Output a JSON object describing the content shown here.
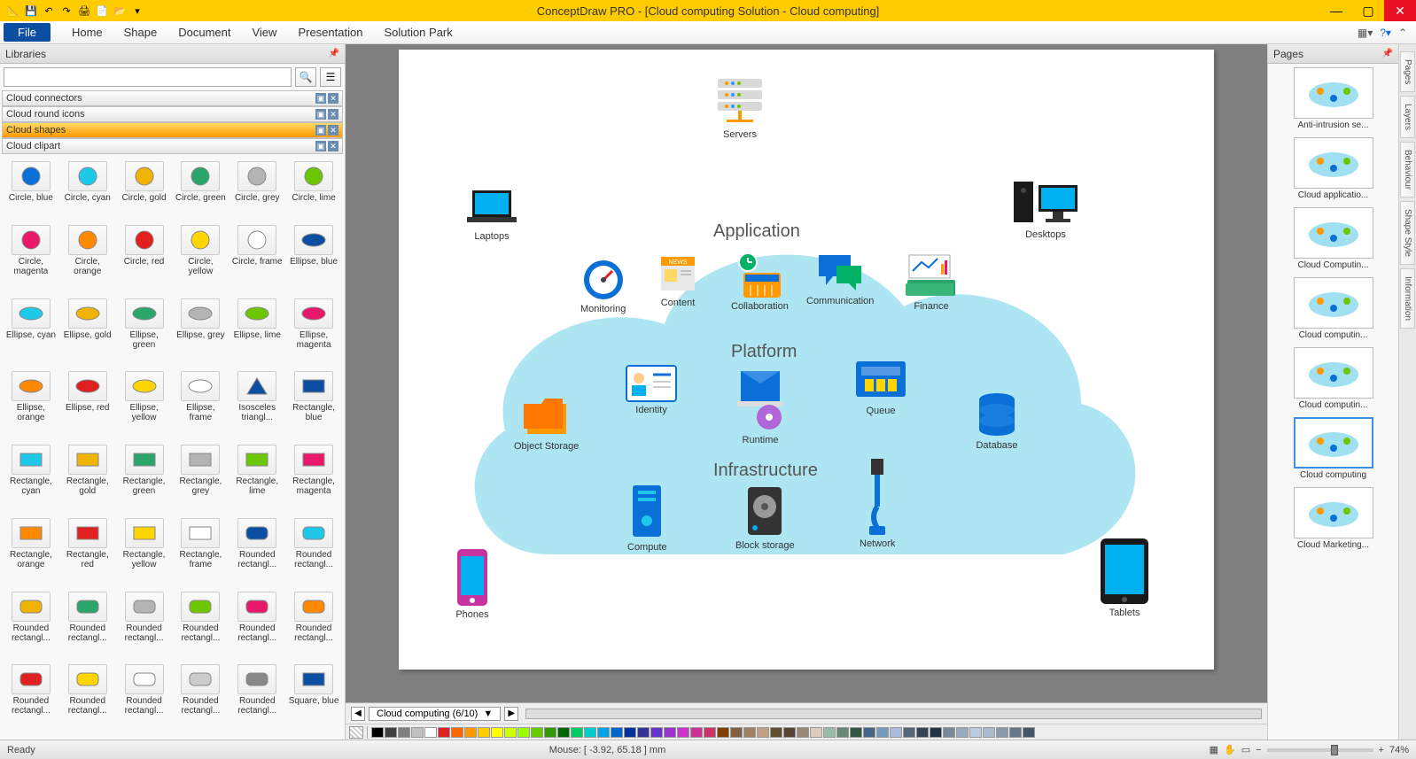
{
  "titlebar": {
    "title": "ConceptDraw PRO - [Cloud computing Solution - Cloud computing]"
  },
  "menubar": {
    "file": "File",
    "items": [
      "Home",
      "Shape",
      "Document",
      "View",
      "Presentation",
      "Solution Park"
    ]
  },
  "libraries": {
    "title": "Libraries",
    "search_placeholder": "",
    "sections": [
      {
        "name": "Cloud connectors",
        "active": false
      },
      {
        "name": "Cloud round icons",
        "active": false
      },
      {
        "name": "Cloud shapes",
        "active": true
      },
      {
        "name": "Cloud clipart",
        "active": false
      }
    ],
    "shapes": [
      {
        "label": "Circle, blue",
        "type": "circle",
        "color": "#0b6fd8"
      },
      {
        "label": "Circle, cyan",
        "type": "circle",
        "color": "#1ec8e8"
      },
      {
        "label": "Circle, gold",
        "type": "circle",
        "color": "#f0b400"
      },
      {
        "label": "Circle, green",
        "type": "circle",
        "color": "#2aa66b"
      },
      {
        "label": "Circle, grey",
        "type": "circle",
        "color": "#b4b4b4"
      },
      {
        "label": "Circle, lime",
        "type": "circle",
        "color": "#6cc600"
      },
      {
        "label": "Circle, magenta",
        "type": "circle",
        "color": "#e8186b"
      },
      {
        "label": "Circle, orange",
        "type": "circle",
        "color": "#ff8a00"
      },
      {
        "label": "Circle, red",
        "type": "circle",
        "color": "#e02020"
      },
      {
        "label": "Circle, yellow",
        "type": "circle",
        "color": "#ffd500"
      },
      {
        "label": "Circle, frame",
        "type": "circle",
        "color": "#ffffff"
      },
      {
        "label": "Ellipse, blue",
        "type": "ellipse",
        "color": "#0b4ea2"
      },
      {
        "label": "Ellipse, cyan",
        "type": "ellipse",
        "color": "#1ec8e8"
      },
      {
        "label": "Ellipse, gold",
        "type": "ellipse",
        "color": "#f0b400"
      },
      {
        "label": "Ellipse, green",
        "type": "ellipse",
        "color": "#2aa66b"
      },
      {
        "label": "Ellipse, grey",
        "type": "ellipse",
        "color": "#b4b4b4"
      },
      {
        "label": "Ellipse, lime",
        "type": "ellipse",
        "color": "#6cc600"
      },
      {
        "label": "Ellipse, magenta",
        "type": "ellipse",
        "color": "#e8186b"
      },
      {
        "label": "Ellipse, orange",
        "type": "ellipse",
        "color": "#ff8a00"
      },
      {
        "label": "Ellipse, red",
        "type": "ellipse",
        "color": "#e02020"
      },
      {
        "label": "Ellipse, yellow",
        "type": "ellipse",
        "color": "#ffd500"
      },
      {
        "label": "Ellipse, frame",
        "type": "ellipse",
        "color": "#ffffff"
      },
      {
        "label": "Isosceles triangl...",
        "type": "triangle",
        "color": "#0b4ea2"
      },
      {
        "label": "Rectangle, blue",
        "type": "rect",
        "color": "#0b4ea2"
      },
      {
        "label": "Rectangle, cyan",
        "type": "rect",
        "color": "#1ec8e8"
      },
      {
        "label": "Rectangle, gold",
        "type": "rect",
        "color": "#f0b400"
      },
      {
        "label": "Rectangle, green",
        "type": "rect",
        "color": "#2aa66b"
      },
      {
        "label": "Rectangle, grey",
        "type": "rect",
        "color": "#b4b4b4"
      },
      {
        "label": "Rectangle, lime",
        "type": "rect",
        "color": "#6cc600"
      },
      {
        "label": "Rectangle, magenta",
        "type": "rect",
        "color": "#e8186b"
      },
      {
        "label": "Rectangle, orange",
        "type": "rect",
        "color": "#ff8a00"
      },
      {
        "label": "Rectangle, red",
        "type": "rect",
        "color": "#e02020"
      },
      {
        "label": "Rectangle, yellow",
        "type": "rect",
        "color": "#ffd500"
      },
      {
        "label": "Rectangle, frame",
        "type": "rect",
        "color": "#ffffff"
      },
      {
        "label": "Rounded rectangl...",
        "type": "rrect",
        "color": "#0b4ea2"
      },
      {
        "label": "Rounded rectangl...",
        "type": "rrect",
        "color": "#1ec8e8"
      },
      {
        "label": "Rounded rectangl...",
        "type": "rrect",
        "color": "#f0b400"
      },
      {
        "label": "Rounded rectangl...",
        "type": "rrect",
        "color": "#2aa66b"
      },
      {
        "label": "Rounded rectangl...",
        "type": "rrect",
        "color": "#b4b4b4"
      },
      {
        "label": "Rounded rectangl...",
        "type": "rrect",
        "color": "#6cc600"
      },
      {
        "label": "Rounded rectangl...",
        "type": "rrect",
        "color": "#e8186b"
      },
      {
        "label": "Rounded rectangl...",
        "type": "rrect",
        "color": "#ff8a00"
      },
      {
        "label": "Rounded rectangl...",
        "type": "rrect",
        "color": "#e02020"
      },
      {
        "label": "Rounded rectangl...",
        "type": "rrect",
        "color": "#ffd500"
      },
      {
        "label": "Rounded rectangl...",
        "type": "rrect",
        "color": "#ffffff"
      },
      {
        "label": "Rounded rectangl...",
        "type": "rrect",
        "color": "#cccccc"
      },
      {
        "label": "Rounded rectangl...",
        "type": "rrect",
        "color": "#888888"
      },
      {
        "label": "Square, blue",
        "type": "rect",
        "color": "#0b4ea2"
      }
    ]
  },
  "diagram": {
    "servers": "Servers",
    "laptops": "Laptops",
    "desktops": "Desktops",
    "application": "Application",
    "platform": "Platform",
    "infrastructure": "Infrastructure",
    "monitoring": "Monitoring",
    "content": "Content",
    "collaboration": "Collaboration",
    "communication": "Communication",
    "finance": "Finance",
    "identity": "Identity",
    "object_storage": "Object Storage",
    "runtime": "Runtime",
    "queue": "Queue",
    "database": "Database",
    "compute": "Compute",
    "block_storage": "Block storage",
    "network": "Network",
    "phones": "Phones",
    "tablets": "Tablets"
  },
  "tab": {
    "name": "Cloud computing (6/10)"
  },
  "colors": [
    "#000000",
    "#404040",
    "#808080",
    "#c0c0c0",
    "#ffffff",
    "#e02020",
    "#ff6600",
    "#ff9900",
    "#ffcc00",
    "#ffff00",
    "#ccff00",
    "#99ff00",
    "#66cc00",
    "#339900",
    "#006600",
    "#00cc66",
    "#00cccc",
    "#00a2e8",
    "#0066cc",
    "#003399",
    "#333399",
    "#6633cc",
    "#9933cc",
    "#cc33cc",
    "#cc3399",
    "#cc3366",
    "#804000",
    "#806040",
    "#a08060",
    "#c0a080",
    "#605030",
    "#554433",
    "#998877",
    "#ddccbb",
    "#99bbaa",
    "#668877",
    "#335544",
    "#446688",
    "#7799bb",
    "#aabbdd",
    "#556677",
    "#334455",
    "#223344",
    "#778899",
    "#99aabb",
    "#bbccdd",
    "#aabbcc",
    "#8899aa",
    "#667788",
    "#445566"
  ],
  "pages": {
    "title": "Pages",
    "items": [
      {
        "name": "Anti-intrusion se...",
        "selected": false
      },
      {
        "name": "Cloud applicatio...",
        "selected": false
      },
      {
        "name": "Cloud Computin...",
        "selected": false
      },
      {
        "name": "Cloud computin...",
        "selected": false
      },
      {
        "name": "Cloud computin...",
        "selected": false
      },
      {
        "name": "Cloud computing",
        "selected": true
      },
      {
        "name": "Cloud Marketing...",
        "selected": false
      }
    ]
  },
  "right_tabs": [
    "Pages",
    "Layers",
    "Behaviour",
    "Shape Style",
    "Information"
  ],
  "status": {
    "ready": "Ready",
    "mouse": "Mouse: [ -3.92, 65.18 ] mm",
    "zoom": "74%"
  }
}
